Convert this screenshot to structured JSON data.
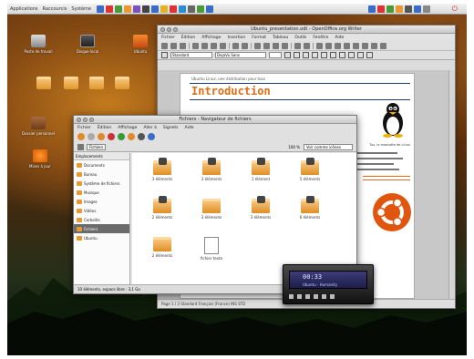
{
  "top_panel": {
    "menus": [
      "Applications",
      "Raccourcis",
      "Système"
    ],
    "launcher_colors": [
      "#3a6ec6",
      "#d33",
      "#4a9a3a",
      "#e79a33",
      "#7a52b8",
      "#444",
      "#3a6ec6",
      "#e5b022",
      "#d33",
      "#2a8fd0",
      "#666",
      "#4a9a3a",
      "#3a6ec6"
    ],
    "tray_colors": [
      "#3a6ec6",
      "#d33",
      "#4a9a3a",
      "#e79a33",
      "#555",
      "#3a6ec6",
      "#888"
    ]
  },
  "desktop_icons": [
    {
      "label": "Poste de travail",
      "kind": "computer"
    },
    {
      "label": "Disque local",
      "kind": "drive"
    },
    {
      "label": "Ubuntu",
      "kind": "red"
    },
    {
      "label": "",
      "kind": "folder"
    },
    {
      "label": "",
      "kind": "folder"
    },
    {
      "label": "",
      "kind": "folder"
    },
    {
      "label": "",
      "kind": "folder"
    },
    {
      "label": "Dossier personnel",
      "kind": "trash"
    },
    {
      "label": "Mises à jour",
      "kind": "alert"
    }
  ],
  "writer": {
    "title": "Ubuntu_presentation.odt - OpenOffice.org Writer",
    "menus": [
      "Fichier",
      "Édition",
      "Affichage",
      "Insertion",
      "Format",
      "Tableau",
      "Outils",
      "Fenêtre",
      "Aide"
    ],
    "style_value": "Standard",
    "font_value": "DejaVu Sans",
    "header_text": "Ubuntu Linux, une distribution pour tous",
    "heading": "Introduction",
    "caption": "Tux, la mascotte de Linux",
    "status": "Page 1 / 3    Standard    Français (France)    INS    STD"
  },
  "nautilus": {
    "title": "Fichiers - Navigateur de fichiers",
    "menus": [
      "Fichier",
      "Édition",
      "Affichage",
      "Aller à",
      "Signets",
      "Aide"
    ],
    "back_label": "Fichiers",
    "zoom": "100 %",
    "view_mode": "Voir comme icônes",
    "side_header": "Emplacements",
    "side_items": [
      "Documents",
      "Bureau",
      "Système de fichiers",
      "Musique",
      "Images",
      "Vidéos",
      "Corbeille",
      "Fichiers",
      "Ubuntu"
    ],
    "selected_side_index": 7,
    "files": [
      {
        "label": "3 éléments",
        "icon": "folder-search"
      },
      {
        "label": "3 éléments",
        "icon": "folder-search"
      },
      {
        "label": "1 élément",
        "icon": "folder-image"
      },
      {
        "label": "5 éléments",
        "icon": "folder-paint"
      },
      {
        "label": "2 éléments",
        "icon": "folder-film"
      },
      {
        "label": "3 éléments",
        "icon": "folder"
      },
      {
        "label": "3 éléments",
        "icon": "folder-web"
      },
      {
        "label": "6 éléments",
        "icon": "folder-tools"
      },
      {
        "label": "2 éléments",
        "icon": "folder"
      },
      {
        "label": "fichier texte",
        "icon": "text-document"
      }
    ],
    "status": "10 éléments, espace libre : 3,1 Go"
  },
  "player": {
    "time": "00:33",
    "track": "Ubuntu - Humanity",
    "lcd_color": "#2b2b66"
  }
}
